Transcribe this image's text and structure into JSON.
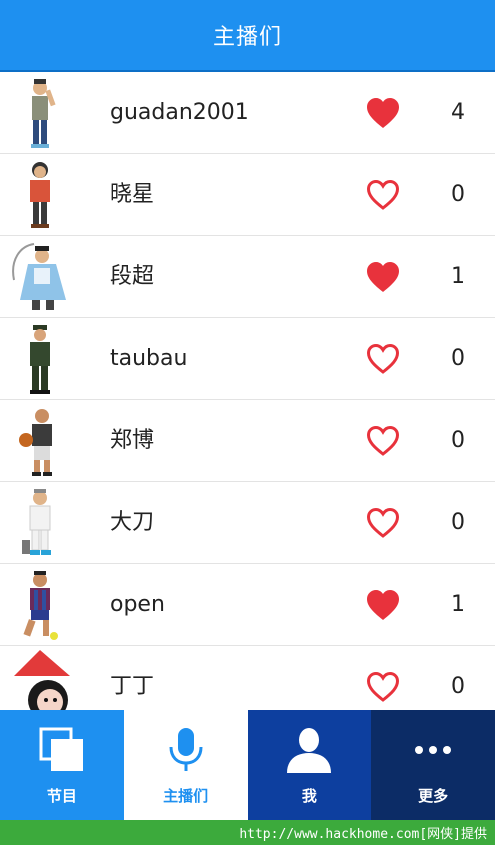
{
  "header": {
    "title": "主播们"
  },
  "anchors": [
    {
      "name": "guadan2001",
      "liked": true,
      "count": "4"
    },
    {
      "name": "晓星",
      "liked": false,
      "count": "0"
    },
    {
      "name": "段超",
      "liked": true,
      "count": "1"
    },
    {
      "name": "taubau",
      "liked": false,
      "count": "0"
    },
    {
      "name": "郑博",
      "liked": false,
      "count": "0"
    },
    {
      "name": "大刀",
      "liked": false,
      "count": "0"
    },
    {
      "name": "open",
      "liked": true,
      "count": "1"
    },
    {
      "name": "丁丁",
      "liked": false,
      "count": "0"
    }
  ],
  "tabs": {
    "programs": {
      "label": "节目",
      "icon": "programs-icon"
    },
    "anchors": {
      "label": "主播们",
      "icon": "microphone-icon"
    },
    "me": {
      "label": "我",
      "icon": "person-icon"
    },
    "more": {
      "label": "更多",
      "icon": "more-dots-icon"
    }
  },
  "footer": {
    "text": "http://www.hackhome.com[网侠]提供"
  },
  "colors": {
    "primary": "#1E90F0",
    "heart": "#E8323C",
    "tab_me": "#0D3F9F",
    "tab_more": "#0C2C66",
    "footer": "#3CAA3C"
  }
}
